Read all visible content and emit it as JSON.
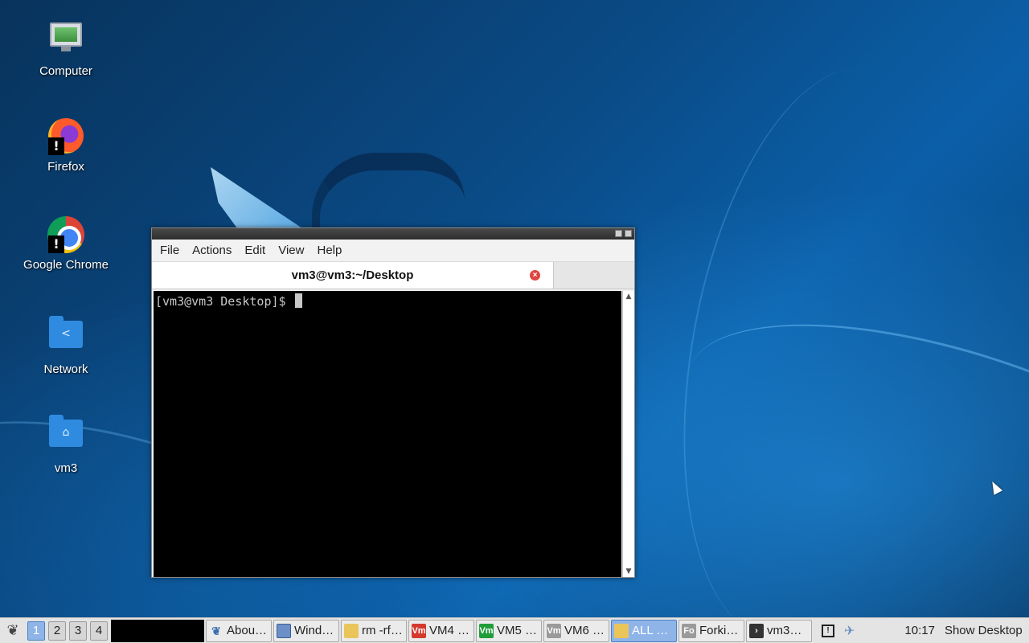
{
  "desktop": {
    "icons": [
      {
        "label": "Computer"
      },
      {
        "label": "Firefox"
      },
      {
        "label": "Google Chrome"
      },
      {
        "label": "Network"
      },
      {
        "label": "vm3"
      }
    ]
  },
  "terminal": {
    "menu": [
      "File",
      "Actions",
      "Edit",
      "View",
      "Help"
    ],
    "tab_title": "vm3@vm3:~/Desktop",
    "prompt": "[vm3@vm3 Desktop]$"
  },
  "taskbar": {
    "workspaces": [
      "1",
      "2",
      "3",
      "4"
    ],
    "active_workspace": "1",
    "tasks": [
      {
        "label": "Abou…",
        "icon": "about-icon"
      },
      {
        "label": "Wind…",
        "icon": "window-icon"
      },
      {
        "label": "rm -rf…",
        "icon": "folder-icon"
      },
      {
        "label": "VM4 …",
        "icon": "vm-icon",
        "badge": "Vm",
        "color": "#d33a2f"
      },
      {
        "label": "VM5 …",
        "icon": "vm-icon",
        "badge": "Vm",
        "color": "#1f9d3a"
      },
      {
        "label": "VM6 …",
        "icon": "vm-icon",
        "badge": "Vm",
        "color": "#9a9a9a"
      },
      {
        "label": "ALL …",
        "icon": "folder-icon"
      },
      {
        "label": "Forki…",
        "icon": "fo-icon",
        "badge": "Fo",
        "color": "#9a9a9a"
      },
      {
        "label": "vm3…",
        "icon": "terminal-icon"
      }
    ],
    "clock": "10:17",
    "show_desktop": "Show Desktop"
  },
  "colors": {
    "active_blue": "#8fb4e8",
    "terminal_bg": "#000000",
    "terminal_fg": "#c8c8c8"
  }
}
